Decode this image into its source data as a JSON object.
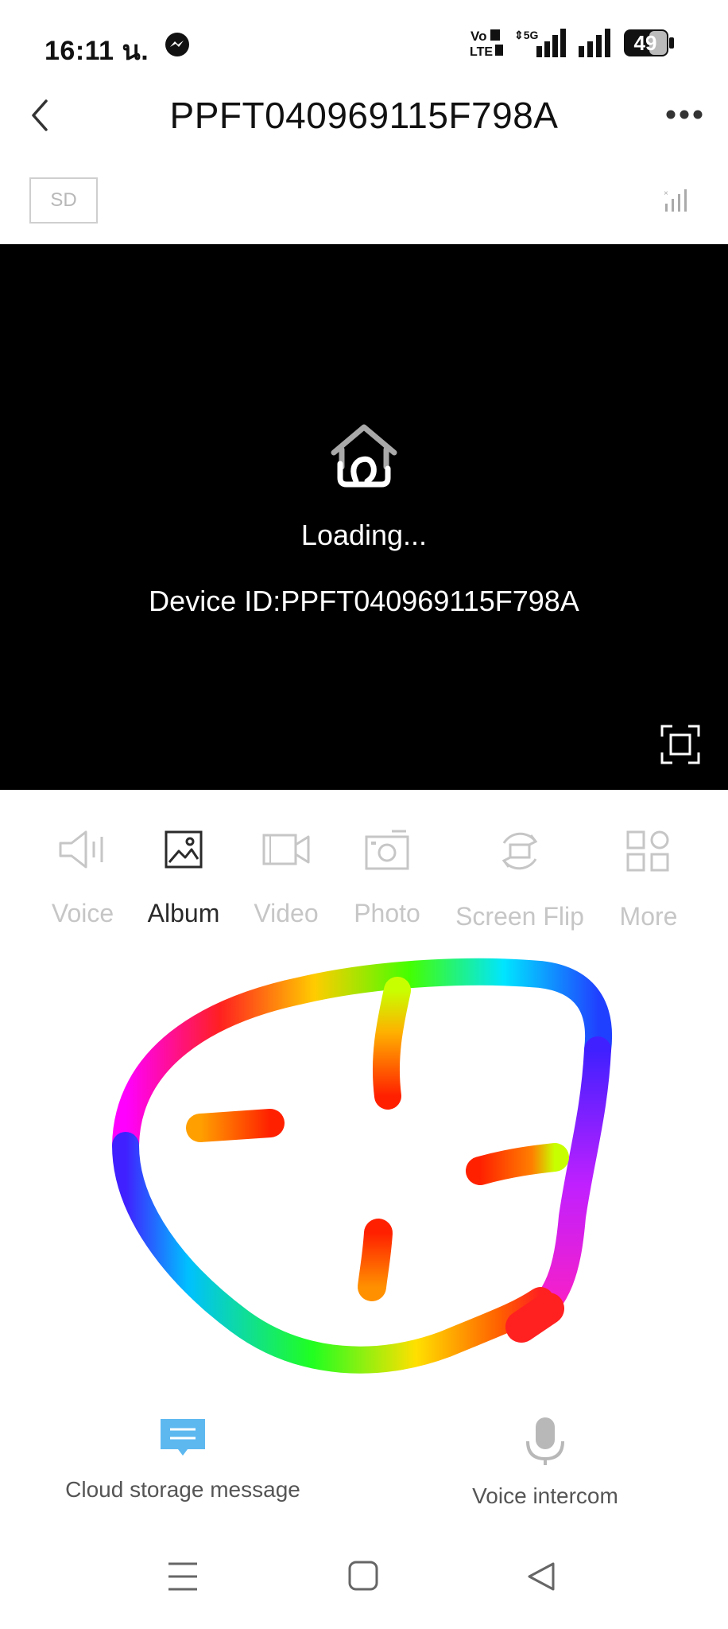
{
  "status_bar": {
    "time": "16:11 น.",
    "battery": "49",
    "network_labels": [
      "Vo",
      "LTE2",
      "5G"
    ]
  },
  "header": {
    "title": "PPFT040969115F798A"
  },
  "sd_label": "SD",
  "video": {
    "loading": "Loading...",
    "device_id": "Device ID:PPFT040969115F798A"
  },
  "toolbar": {
    "items": [
      {
        "label": "Voice",
        "icon": "speaker-icon",
        "state": "disabled"
      },
      {
        "label": "Album",
        "icon": "image-icon",
        "state": "active"
      },
      {
        "label": "Video",
        "icon": "video-camera-icon",
        "state": "disabled"
      },
      {
        "label": "Photo",
        "icon": "camera-icon",
        "state": "disabled"
      },
      {
        "label": "Screen Flip",
        "icon": "flip-icon",
        "state": "disabled"
      },
      {
        "label": "More",
        "icon": "grid-icon",
        "state": "disabled"
      }
    ]
  },
  "bottom_actions": {
    "cloud": "Cloud storage message",
    "voice": "Voice intercom"
  },
  "colors": {
    "accent_blue": "#5db8f0",
    "disabled_gray": "#c6c6c6",
    "video_bg": "#000000"
  }
}
